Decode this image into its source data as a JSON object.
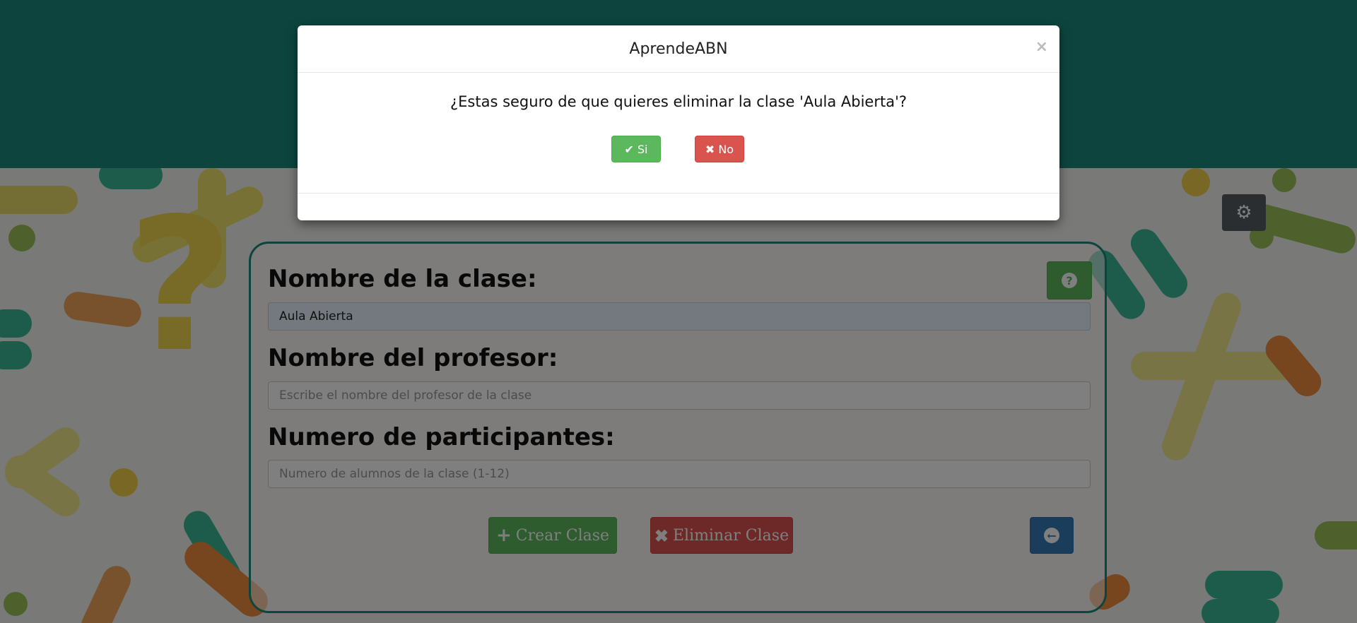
{
  "background": {
    "header_color": "#1a8a7c",
    "accent_green": "#5cb85c",
    "accent_red": "#d9534f",
    "accent_blue": "#337ab7"
  },
  "settings": {
    "icon": "gear-icon"
  },
  "form": {
    "class_name_label": "Nombre de la clase:",
    "class_name_value": "Aula Abierta",
    "teacher_label": "Nombre del profesor:",
    "teacher_placeholder": "Escribe el nombre del profesor de la clase",
    "participants_label": "Numero de participantes:",
    "participants_placeholder": "Numero de alumnos de la clase (1-12)",
    "create_label": "Crear Clase",
    "delete_label": "Eliminar Clase",
    "help_icon": "question-circle-icon",
    "back_icon": "arrow-circle-left-icon"
  },
  "modal": {
    "title": "AprendeABN",
    "close": "×",
    "message": "¿Estas seguro de que quieres eliminar la clase 'Aula Abierta'?",
    "yes_label": "Si",
    "no_label": "No"
  }
}
